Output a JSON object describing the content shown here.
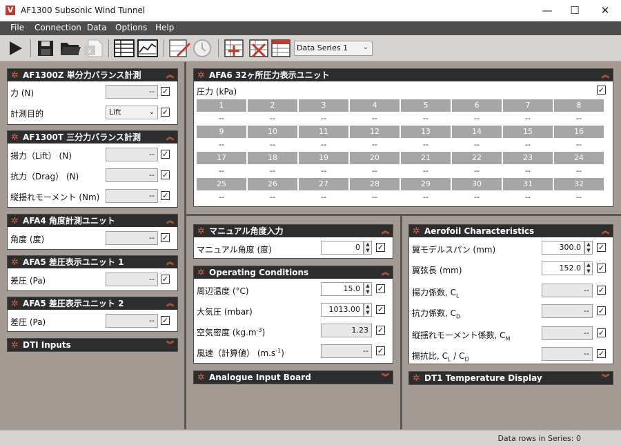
{
  "window": {
    "title": "AF1300 Subsonic Wind Tunnel",
    "logo": "V",
    "minimize": "—",
    "maximize": "☐",
    "close": "✕"
  },
  "menu": [
    "File",
    "Connection",
    "Data",
    "Options",
    "Help"
  ],
  "toolbar": {
    "icons": [
      "play-icon",
      "save-icon",
      "open-folder-icon",
      "export-excel-icon",
      "table-view-icon",
      "chart-view-icon",
      "edit-chart-icon",
      "clock-icon",
      "add-series-icon",
      "delete-series-icon",
      "series-settings-icon"
    ],
    "series_select": "Data Series 1"
  },
  "left": {
    "af1300z": {
      "title": "AF1300Z 単分力バランス計測",
      "force_label": "力 (N)",
      "force_value": "--",
      "purpose_label": "計測目的",
      "purpose_value": "Lift"
    },
    "af1300t": {
      "title": "AF1300T 三分力バランス計測",
      "lift_label": "揚力（Lift）  (N)",
      "lift_value": "--",
      "drag_label": "抗力（Drag）  (N)",
      "drag_value": "--",
      "moment_label": "縦揺れモーメント (Nm)",
      "moment_value": "--"
    },
    "afa4": {
      "title": "AFA4 角度計測ユニット",
      "angle_label": "角度  (度)",
      "angle_value": "--"
    },
    "afa5_1": {
      "title": "AFA5 差圧表示ユニット 1",
      "dp_label": "差圧  (Pa)",
      "dp_value": "--"
    },
    "afa5_2": {
      "title": "AFA5 差圧表示ユニット 2",
      "dp_label": "差圧  (Pa)",
      "dp_value": "--"
    },
    "dti": {
      "title": "DTI Inputs"
    }
  },
  "afa6": {
    "title": "AFA6 32ヶ所圧力表示ユニット",
    "pressure_label": "圧力 (kPa)",
    "ports": [
      "1",
      "2",
      "3",
      "4",
      "5",
      "6",
      "7",
      "8",
      "9",
      "10",
      "11",
      "12",
      "13",
      "14",
      "15",
      "16",
      "17",
      "18",
      "19",
      "20",
      "21",
      "22",
      "23",
      "24",
      "25",
      "26",
      "27",
      "28",
      "29",
      "30",
      "31",
      "32"
    ],
    "values": [
      "--",
      "--",
      "--",
      "--",
      "--",
      "--",
      "--",
      "--",
      "--",
      "--",
      "--",
      "--",
      "--",
      "--",
      "--",
      "--",
      "--",
      "--",
      "--",
      "--",
      "--",
      "--",
      "--",
      "--",
      "--",
      "--",
      "--",
      "--",
      "--",
      "--",
      "--",
      "--"
    ]
  },
  "manual_angle": {
    "title": "マニュアル角度入力",
    "label": "マニュアル角度  (度)",
    "value": "0"
  },
  "operating": {
    "title": "Operating Conditions",
    "temp_label": "周辺温度  (°C)",
    "temp_value": "15.0",
    "pressure_label": "大気圧  (mbar)",
    "pressure_value": "1013.00",
    "density_label": "空気密度  (kg.m",
    "density_sup": "-3",
    "density_suffix": ")",
    "density_value": "1.23",
    "wind_label": "風速（計算値）  (m.s",
    "wind_sup": "-1",
    "wind_suffix": ")",
    "wind_value": "--"
  },
  "analogue": {
    "title": "Analogue Input Board"
  },
  "aerofoil": {
    "title": "Aerofoil Characteristics",
    "span_label": "翼モデルスパン  (mm)",
    "span_value": "300.0",
    "chord_label": "翼弦長  (mm)",
    "chord_value": "152.0",
    "cl_label": "揚力係数, C",
    "cl_sub": "L",
    "cl_value": "--",
    "cd_label": "抗力係数, C",
    "cd_sub": "D",
    "cd_value": "--",
    "cm_label": "縦揺れモーメント係数, C",
    "cm_sub": "M",
    "cm_value": "--",
    "ld_label_a": "揚抗比, C",
    "ld_sub_a": "L",
    "ld_label_b": " / C",
    "ld_sub_b": "D",
    "ld_value": "--"
  },
  "dt1": {
    "title": "DT1 Temperature Display"
  },
  "status": {
    "text": "Data rows in Series: 0"
  },
  "glyphs": {
    "check": "✓",
    "chevron_up": "︽",
    "chevron_down": "︾",
    "gear": "✲",
    "dropdown": "⌄",
    "spin_up": "▲",
    "spin_down": "▼"
  },
  "colors": {
    "accent": "#d35f3c",
    "header": "#2d2d2d",
    "panel": "#a39a93",
    "menubar": "#4d4d4d"
  }
}
